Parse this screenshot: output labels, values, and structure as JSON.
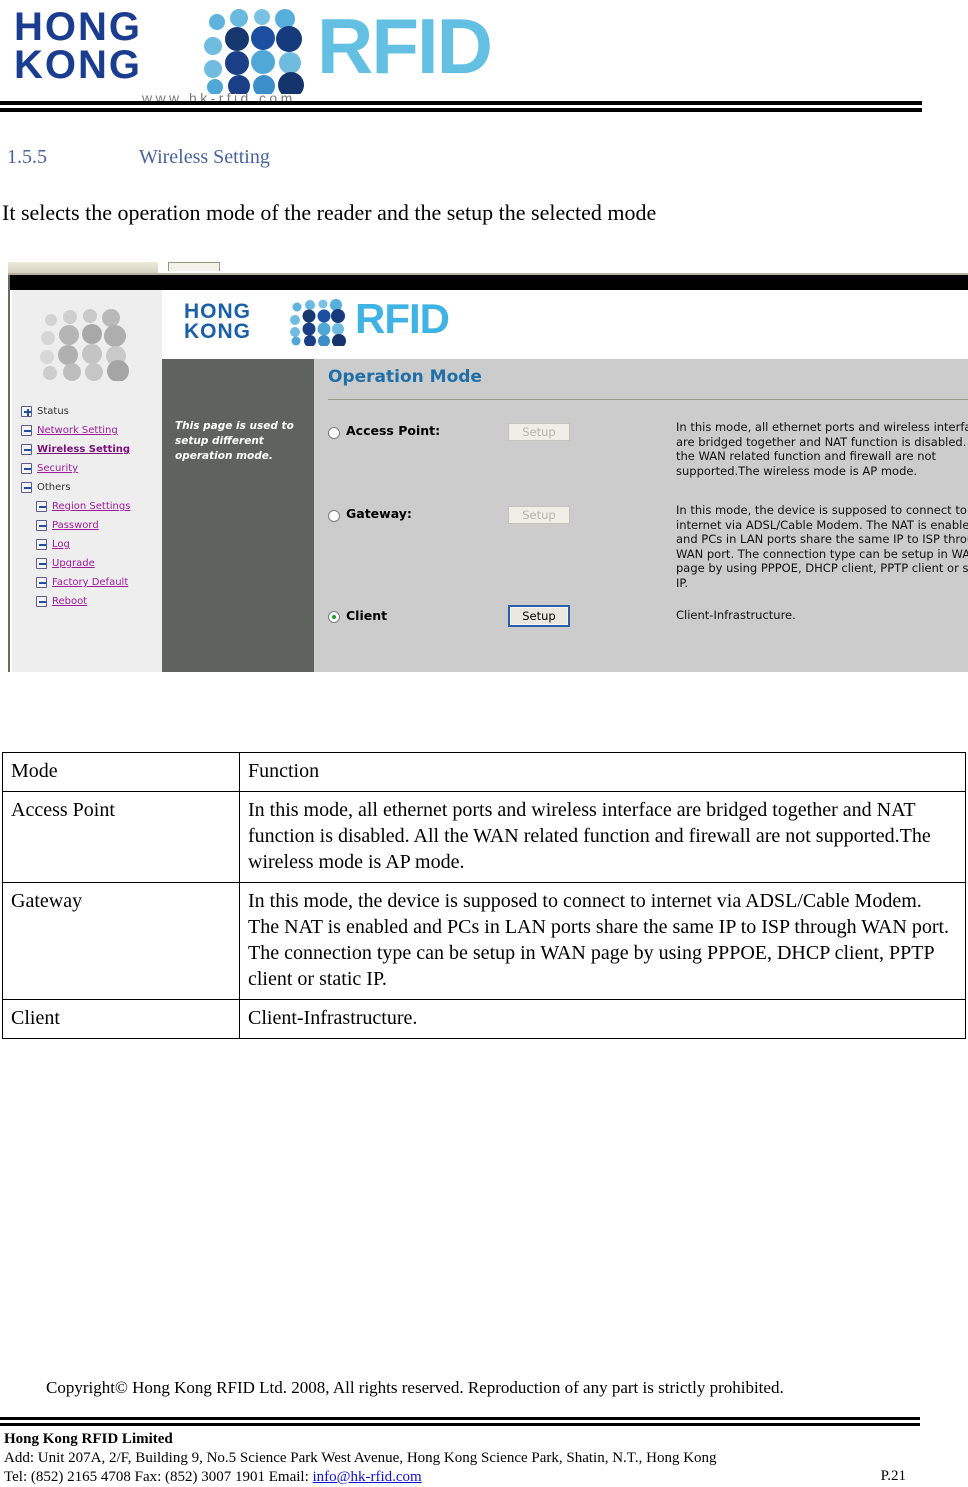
{
  "header": {
    "logo_line1": "HONG",
    "logo_line2": "KONG",
    "logo_word": "RFID",
    "logo_url": "www.hk-rfid.com"
  },
  "section": {
    "number": "1.5.5",
    "title": "Wireless Setting",
    "intro": "It selects the operation mode of the reader and the setup the selected mode"
  },
  "screenshot": {
    "ui_logo_line1": "HONG",
    "ui_logo_line2": "KONG",
    "ui_logo_word": "RFID",
    "help_text": "This page is used to setup different operation mode.",
    "nav": [
      {
        "label": "Status",
        "icon": "plus-box-icon",
        "style": "plain",
        "sub": false
      },
      {
        "label": "Network Setting",
        "icon": "minus-box-icon",
        "style": "link",
        "sub": false
      },
      {
        "label": "Wireless Setting",
        "icon": "minus-box-icon",
        "style": "current",
        "sub": false
      },
      {
        "label": "Security",
        "icon": "minus-box-icon",
        "style": "link",
        "sub": false
      },
      {
        "label": "Others",
        "icon": "minus-box-icon",
        "style": "plain",
        "sub": false
      },
      {
        "label": "Region Settings",
        "icon": "minus-box-icon",
        "style": "link",
        "sub": true
      },
      {
        "label": "Password",
        "icon": "minus-box-icon",
        "style": "link",
        "sub": true
      },
      {
        "label": "Log",
        "icon": "minus-box-icon",
        "style": "link",
        "sub": true
      },
      {
        "label": "Upgrade",
        "icon": "minus-box-icon",
        "style": "link",
        "sub": true
      },
      {
        "label": "Factory Default",
        "icon": "minus-box-icon",
        "style": "link",
        "sub": true
      },
      {
        "label": "Reboot",
        "icon": "minus-box-icon",
        "style": "link",
        "sub": true
      }
    ],
    "pane_title": "Operation Mode",
    "setup_label": "Setup",
    "modes": [
      {
        "label": "Access Point:",
        "selected": false,
        "button_enabled": false,
        "description": "In this mode, all ethernet ports and wireless interface are bridged together and NAT function is disabled. All the WAN related function and firewall are not supported.The wireless mode is AP mode."
      },
      {
        "label": "Gateway:",
        "selected": false,
        "button_enabled": false,
        "description": "In this mode, the device is supposed to connect to internet via ADSL/Cable Modem. The NAT is enabled and PCs in LAN ports share the same IP to ISP through WAN port. The connection type can be setup in WAN page by using PPPOE, DHCP client, PPTP client or static IP."
      },
      {
        "label": "Client",
        "selected": true,
        "button_enabled": true,
        "description": "Client-Infrastructure."
      }
    ]
  },
  "table": {
    "headers": [
      "Mode",
      "Function"
    ],
    "rows": [
      [
        "Access Point",
        "In this mode, all ethernet ports and wireless interface are bridged together and NAT function is disabled. All the WAN related function and firewall are not supported.The wireless mode is AP mode."
      ],
      [
        "Gateway",
        "In this mode, the device is supposed to connect to internet via ADSL/Cable Modem. The NAT is enabled and PCs in LAN ports share the same IP to ISP through WAN port. The connection type can be setup in WAN page by using PPPOE, DHCP client, PPTP client or static IP."
      ],
      [
        "Client",
        "Client-Infrastructure."
      ]
    ]
  },
  "footer": {
    "copyright": "Copyright© Hong Kong RFID Ltd. 2008, All rights reserved. Reproduction of any part is strictly prohibited.",
    "company": "Hong Kong RFID Limited",
    "address": "Add: Unit 207A, 2/F, Building 9, No.5 Science Park West Avenue, Hong Kong Science Park, Shatin, N.T., Hong Kong",
    "contact_prefix": "Tel: (852) 2165 4708   Fax: (852) 3007 1901   Email: ",
    "email": "info@hk-rfid.com",
    "page_number": "P.21"
  },
  "colors": {
    "brand_dark_blue": "#1B3D8F",
    "brand_light_blue": "#63C0E3",
    "heading_blue": "#48639C",
    "nav_link_purple": "#9B1B9B",
    "pane_title_blue": "#1F6FA8",
    "radio_on_green": "#1F9E1F",
    "help_panel_gray": "#5F625E"
  }
}
